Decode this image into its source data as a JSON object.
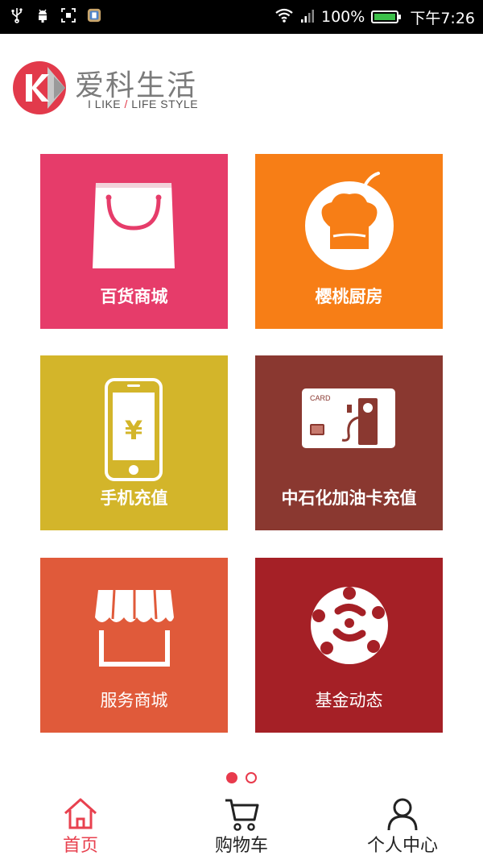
{
  "status_bar": {
    "left_icons": [
      "usb-icon",
      "android-debug-icon",
      "screenshot-icon",
      "app-notification-icon"
    ],
    "battery_text": "100%",
    "time": "下午7:26",
    "battery_level": 1.0,
    "battery_color": "#3cc04a"
  },
  "logo": {
    "title": "爱科生活",
    "subtitle_part1": "I LIKE ",
    "subtitle_slash": "/",
    "subtitle_part2": " LIFE STYLE",
    "brand_color": "#e23a4b"
  },
  "tiles": [
    {
      "label": "百货商城",
      "color": "#e63c6a",
      "icon": "shopping-bag-icon"
    },
    {
      "label": "樱桃厨房",
      "color": "#f77e16",
      "icon": "chef-hat-icon"
    },
    {
      "label": "手机充值",
      "color": "#d3b52a",
      "icon": "phone-yen-icon"
    },
    {
      "label": "中石化加油卡充值",
      "color": "#8a3830",
      "icon": "fuel-card-icon"
    },
    {
      "label": "服务商城",
      "color": "#e05a3a",
      "icon": "storefront-icon"
    },
    {
      "label": "基金动态",
      "color": "#a52026",
      "icon": "fund-flower-icon"
    }
  ],
  "pager": {
    "total": 2,
    "active_index": 0,
    "color": "#e83a4c"
  },
  "bottom_nav": [
    {
      "label": "首页",
      "icon": "home-icon",
      "active": true
    },
    {
      "label": "购物车",
      "icon": "cart-icon",
      "active": false
    },
    {
      "label": "个人中心",
      "icon": "person-icon",
      "active": false
    }
  ],
  "accent_color": "#e8414f"
}
